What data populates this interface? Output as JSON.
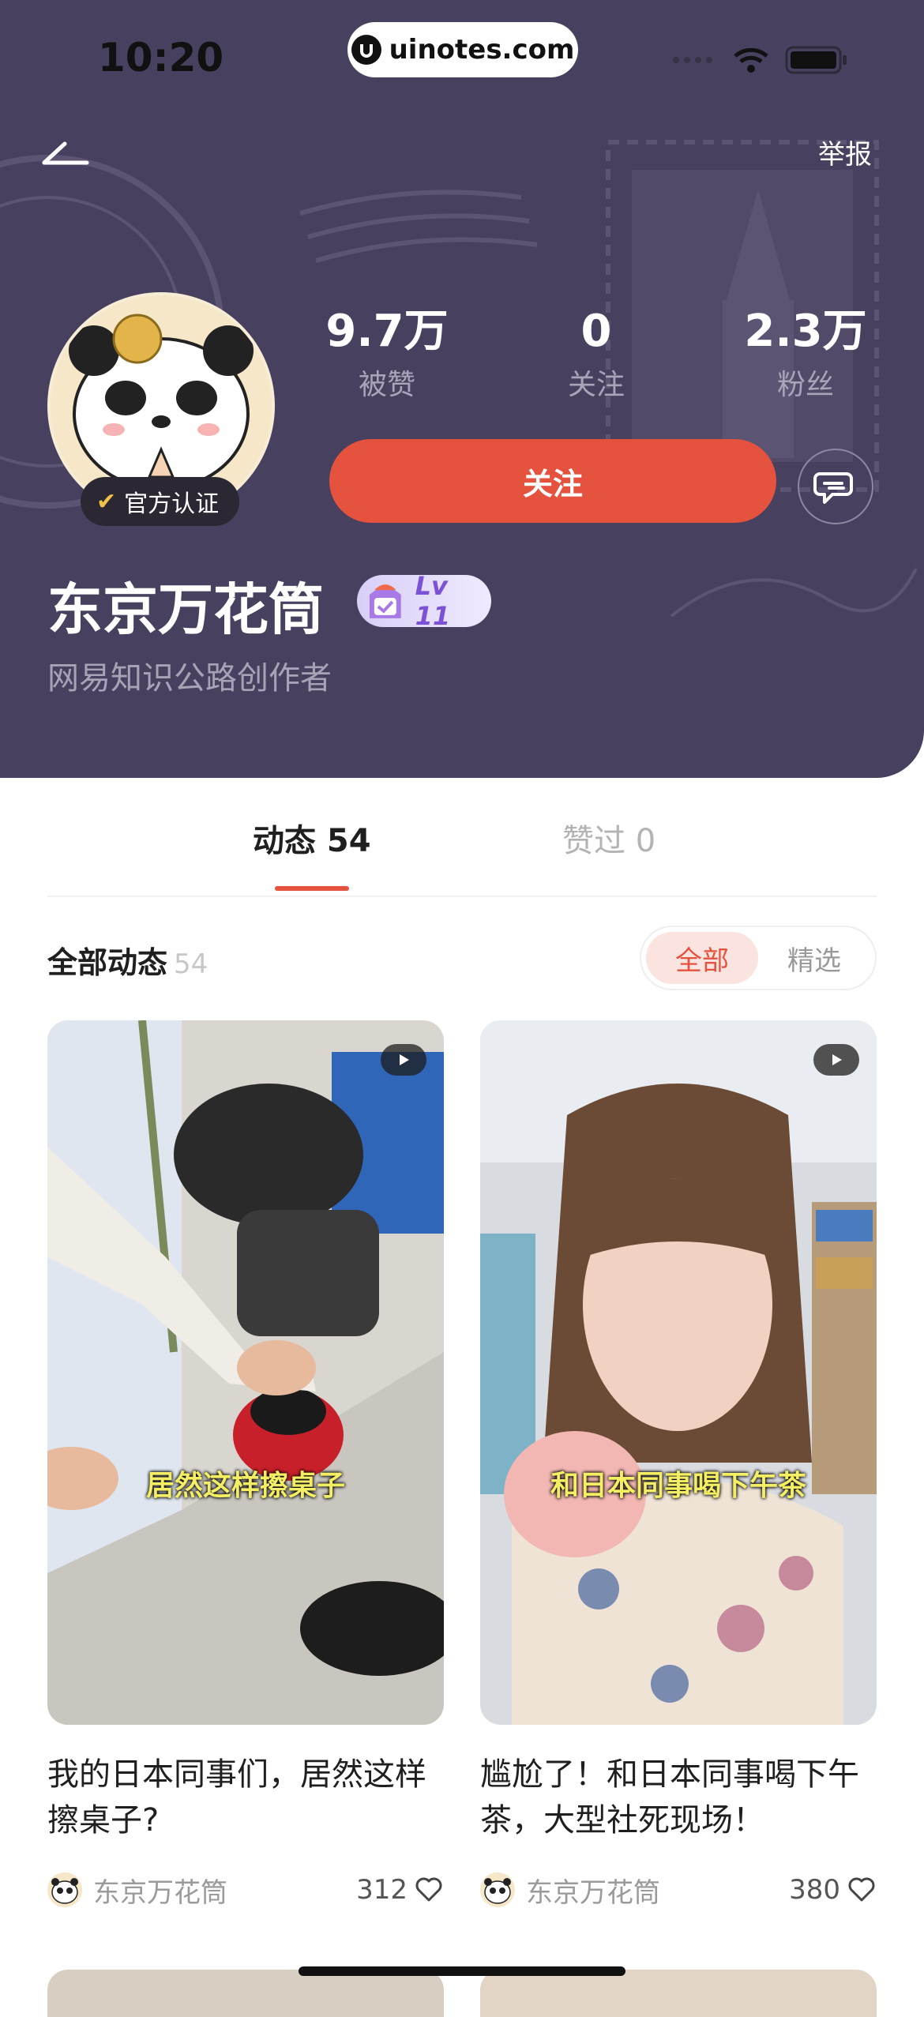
{
  "status": {
    "time": "10:20",
    "url": "uinotes.com"
  },
  "header": {
    "report_label": "举报"
  },
  "profile": {
    "verified_label": "官方认证",
    "name": "东京万花筒",
    "level": "Lv 11",
    "subtitle": "网易知识公路创作者",
    "stats": [
      {
        "value": "9.7万",
        "label": "被赞"
      },
      {
        "value": "0",
        "label": "关注"
      },
      {
        "value": "2.3万",
        "label": "粉丝"
      }
    ],
    "follow_label": "关注"
  },
  "tabs": [
    {
      "label": "动态 54",
      "active": true
    },
    {
      "label": "赞过 0",
      "active": false
    }
  ],
  "section": {
    "title": "全部动态",
    "count": "54",
    "filters": [
      "全部",
      "精选"
    ]
  },
  "cards": [
    {
      "caption": "居然这样擦桌子",
      "title": "我的日本同事们，居然这样擦桌子?",
      "author": "东京万花筒",
      "likes": "312"
    },
    {
      "caption": "和日本同事喝下午茶",
      "title": "尴尬了！和日本同事喝下午茶，大型社死现场！",
      "author": "东京万花筒",
      "likes": "380"
    }
  ],
  "colors": {
    "header_bg": "#48405f",
    "accent": "#e5533f",
    "level_text": "#7b52d6"
  },
  "icons": [
    "back-arrow-icon",
    "message-icon",
    "check-icon",
    "play-icon",
    "heart-icon",
    "wifi-icon",
    "battery-icon"
  ]
}
